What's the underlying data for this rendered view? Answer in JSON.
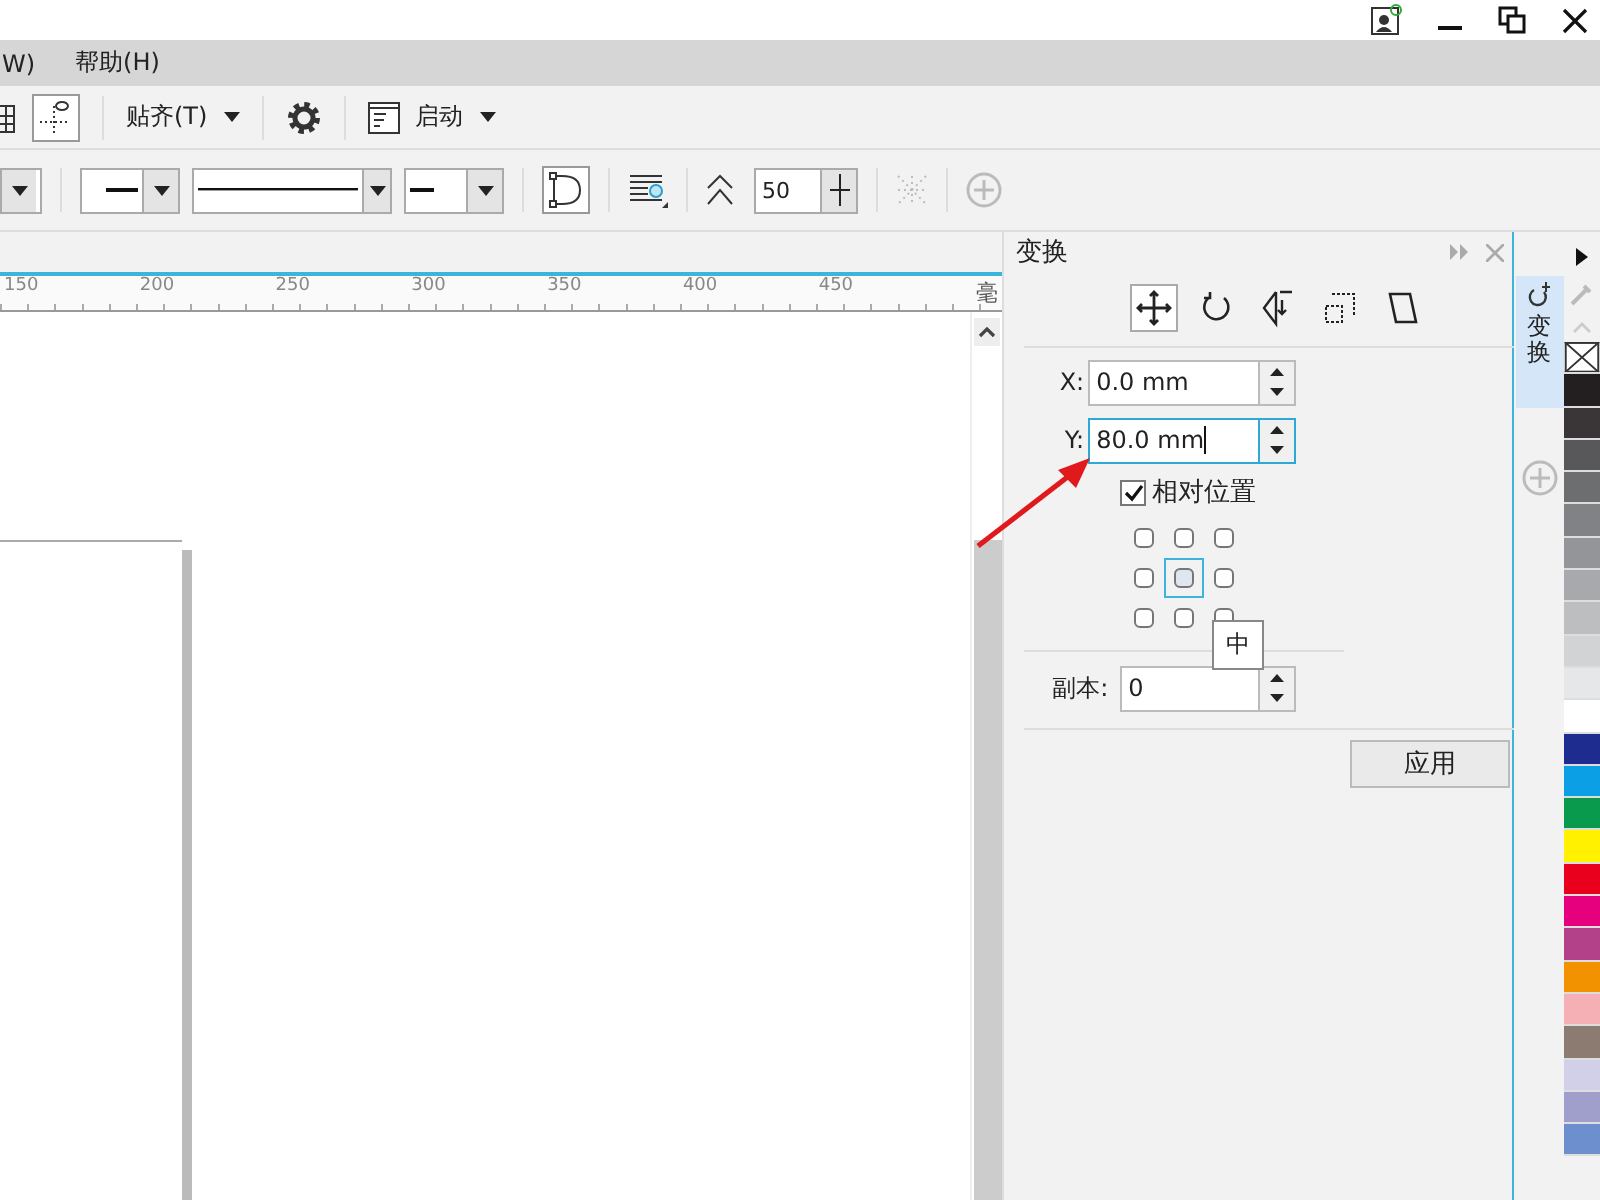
{
  "menu": [
    {
      "label": "W)"
    },
    {
      "label": "帮助(H)"
    }
  ],
  "toolbar": {
    "snap_label": "贴齐(T)",
    "launch_label": "启动"
  },
  "property_bar": {
    "smoothing_value": "50"
  },
  "ruler": {
    "labels": [
      "150",
      "200",
      "250",
      "300",
      "350",
      "400",
      "450"
    ],
    "unit": "毫"
  },
  "docker": {
    "title": "变换",
    "tools": [
      {
        "selected": true
      },
      {
        "selected": false
      },
      {
        "selected": false
      },
      {
        "selected": false
      },
      {
        "selected": false
      }
    ],
    "x": {
      "label": "X:",
      "value": "0.0 mm",
      "focused": false
    },
    "y": {
      "label": "Y:",
      "value": "80.0 mm",
      "focused": true
    },
    "relative_position": {
      "label": "相对位置",
      "checked": true
    },
    "anchors": [
      {
        "selected": false
      },
      {
        "selected": false
      },
      {
        "selected": false
      },
      {
        "selected": false
      },
      {
        "selected": true
      },
      {
        "selected": false
      },
      {
        "selected": false
      },
      {
        "selected": false
      },
      {
        "selected": false
      }
    ],
    "tooltip": "中",
    "copies": {
      "label": "副本:",
      "value": "0"
    },
    "apply": "应用"
  },
  "side_tab": {
    "label": "变换",
    "selected": true
  },
  "palette": [
    {
      "kind": "none"
    },
    {
      "kind": "swatch",
      "color": "#231f20"
    },
    {
      "kind": "swatch",
      "color": "#3a3536"
    },
    {
      "kind": "swatch",
      "color": "#58585a"
    },
    {
      "kind": "swatch",
      "color": "#6d6e70"
    },
    {
      "kind": "swatch",
      "color": "#808285"
    },
    {
      "kind": "swatch",
      "color": "#939598"
    },
    {
      "kind": "swatch",
      "color": "#a7a9ac"
    },
    {
      "kind": "swatch",
      "color": "#bcbec0"
    },
    {
      "kind": "swatch",
      "color": "#d1d3d4"
    },
    {
      "kind": "swatch",
      "color": "#e6e7e8"
    },
    {
      "kind": "swatch",
      "color": "#ffffff"
    },
    {
      "kind": "swatch",
      "color": "#1e2c8f"
    },
    {
      "kind": "swatch",
      "color": "#0ba0e6"
    },
    {
      "kind": "swatch",
      "color": "#0a9a4e"
    },
    {
      "kind": "swatch",
      "color": "#fff100"
    },
    {
      "kind": "swatch",
      "color": "#e8001d"
    },
    {
      "kind": "swatch",
      "color": "#e6007e"
    },
    {
      "kind": "swatch",
      "color": "#b3418a"
    },
    {
      "kind": "swatch",
      "color": "#f39200"
    },
    {
      "kind": "swatch",
      "color": "#f4b0b4"
    },
    {
      "kind": "swatch",
      "color": "#8c7b70"
    },
    {
      "kind": "swatch",
      "color": "#d1d0e8"
    },
    {
      "kind": "swatch",
      "color": "#a09fcc"
    },
    {
      "kind": "swatch",
      "color": "#6d8fce"
    }
  ]
}
